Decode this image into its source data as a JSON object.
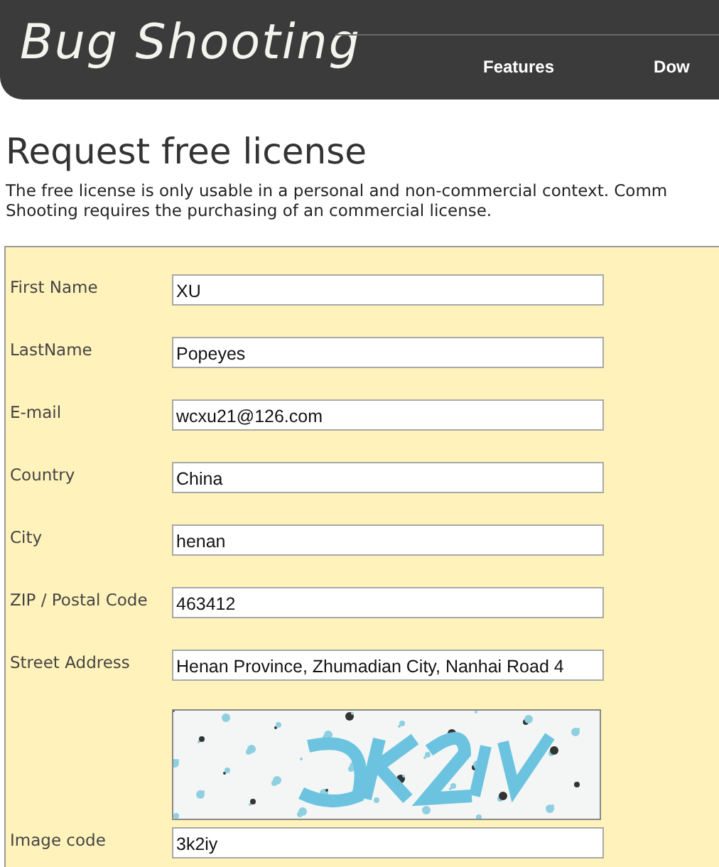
{
  "header": {
    "logo": "Bug Shooting",
    "nav": [
      {
        "label": "Features"
      },
      {
        "label": "Dow"
      }
    ]
  },
  "title": "Request free license",
  "intro": [
    "The free license is only usable in a personal and non-commercial context. Comm",
    "Shooting requires the purchasing of an commercial license."
  ],
  "form": [
    {
      "kind": "text",
      "label": "First Name",
      "value": "XU"
    },
    {
      "kind": "text",
      "label": "LastName",
      "value": "Popeyes"
    },
    {
      "kind": "text",
      "label": "E-mail",
      "value": "wcxu21@126.com"
    },
    {
      "kind": "text",
      "label": "Country",
      "value": "China"
    },
    {
      "kind": "text",
      "label": "City",
      "value": "henan"
    },
    {
      "kind": "text",
      "label": "ZIP / Postal Code",
      "value": "463412"
    },
    {
      "kind": "text",
      "label": "Street Address",
      "value": "Henan Province, Zhumadian City, Nanhai Road 4"
    },
    {
      "kind": "captcha"
    },
    {
      "kind": "text",
      "label": "Image code",
      "value": "3k2iy"
    }
  ]
}
